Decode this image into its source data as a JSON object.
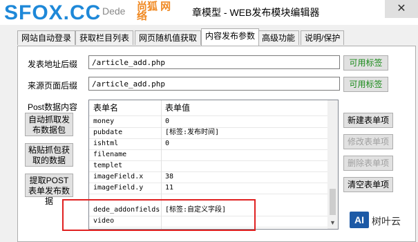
{
  "window": {
    "title_prefix": "Dede",
    "title": "章模型 - WEB发布模块编辑器",
    "close_label": "✕"
  },
  "watermark": {
    "main": "SFOX.CC",
    "sub": "尚狐 网络"
  },
  "tabs": [
    {
      "label": "网站自动登录"
    },
    {
      "label": "获取栏目列表"
    },
    {
      "label": "网页随机值获取"
    },
    {
      "label": "内容发布参数"
    },
    {
      "label": "高级功能"
    },
    {
      "label": "说明/保护"
    }
  ],
  "form": {
    "post_url_label": "发表地址后缀",
    "post_url_value": "/article_add.php",
    "referer_label": "来源页面后缀",
    "referer_value": "/article_add.php",
    "available_tags_label": "可用标签",
    "post_data_label": "Post数据内容"
  },
  "left_buttons": {
    "auto_capture": "自动抓取发布数据包",
    "paste_capture": "粘贴抓包获取的数据",
    "extract_post": "提取POST表单发布数据"
  },
  "grid": {
    "col_name": "表单名",
    "col_value": "表单值",
    "rows": [
      {
        "name": "money",
        "value": "0"
      },
      {
        "name": "pubdate",
        "value": "[标签:发布时间]"
      },
      {
        "name": "ishtml",
        "value": "0"
      },
      {
        "name": "filename",
        "value": ""
      },
      {
        "name": "templet",
        "value": ""
      },
      {
        "name": "imageField.x",
        "value": "38"
      },
      {
        "name": "imageField.y",
        "value": "11"
      },
      {
        "name": "dede_addonfields",
        "value": "[标签:自定义字段]"
      },
      {
        "name": "video",
        "value": ""
      }
    ]
  },
  "right_buttons": {
    "new_item": "新建表单项",
    "edit_item": "修改表单项",
    "delete_item": "删除表单项",
    "clear_item": "清空表单项"
  },
  "brand": {
    "logo": "AI",
    "text": "树叶云"
  }
}
